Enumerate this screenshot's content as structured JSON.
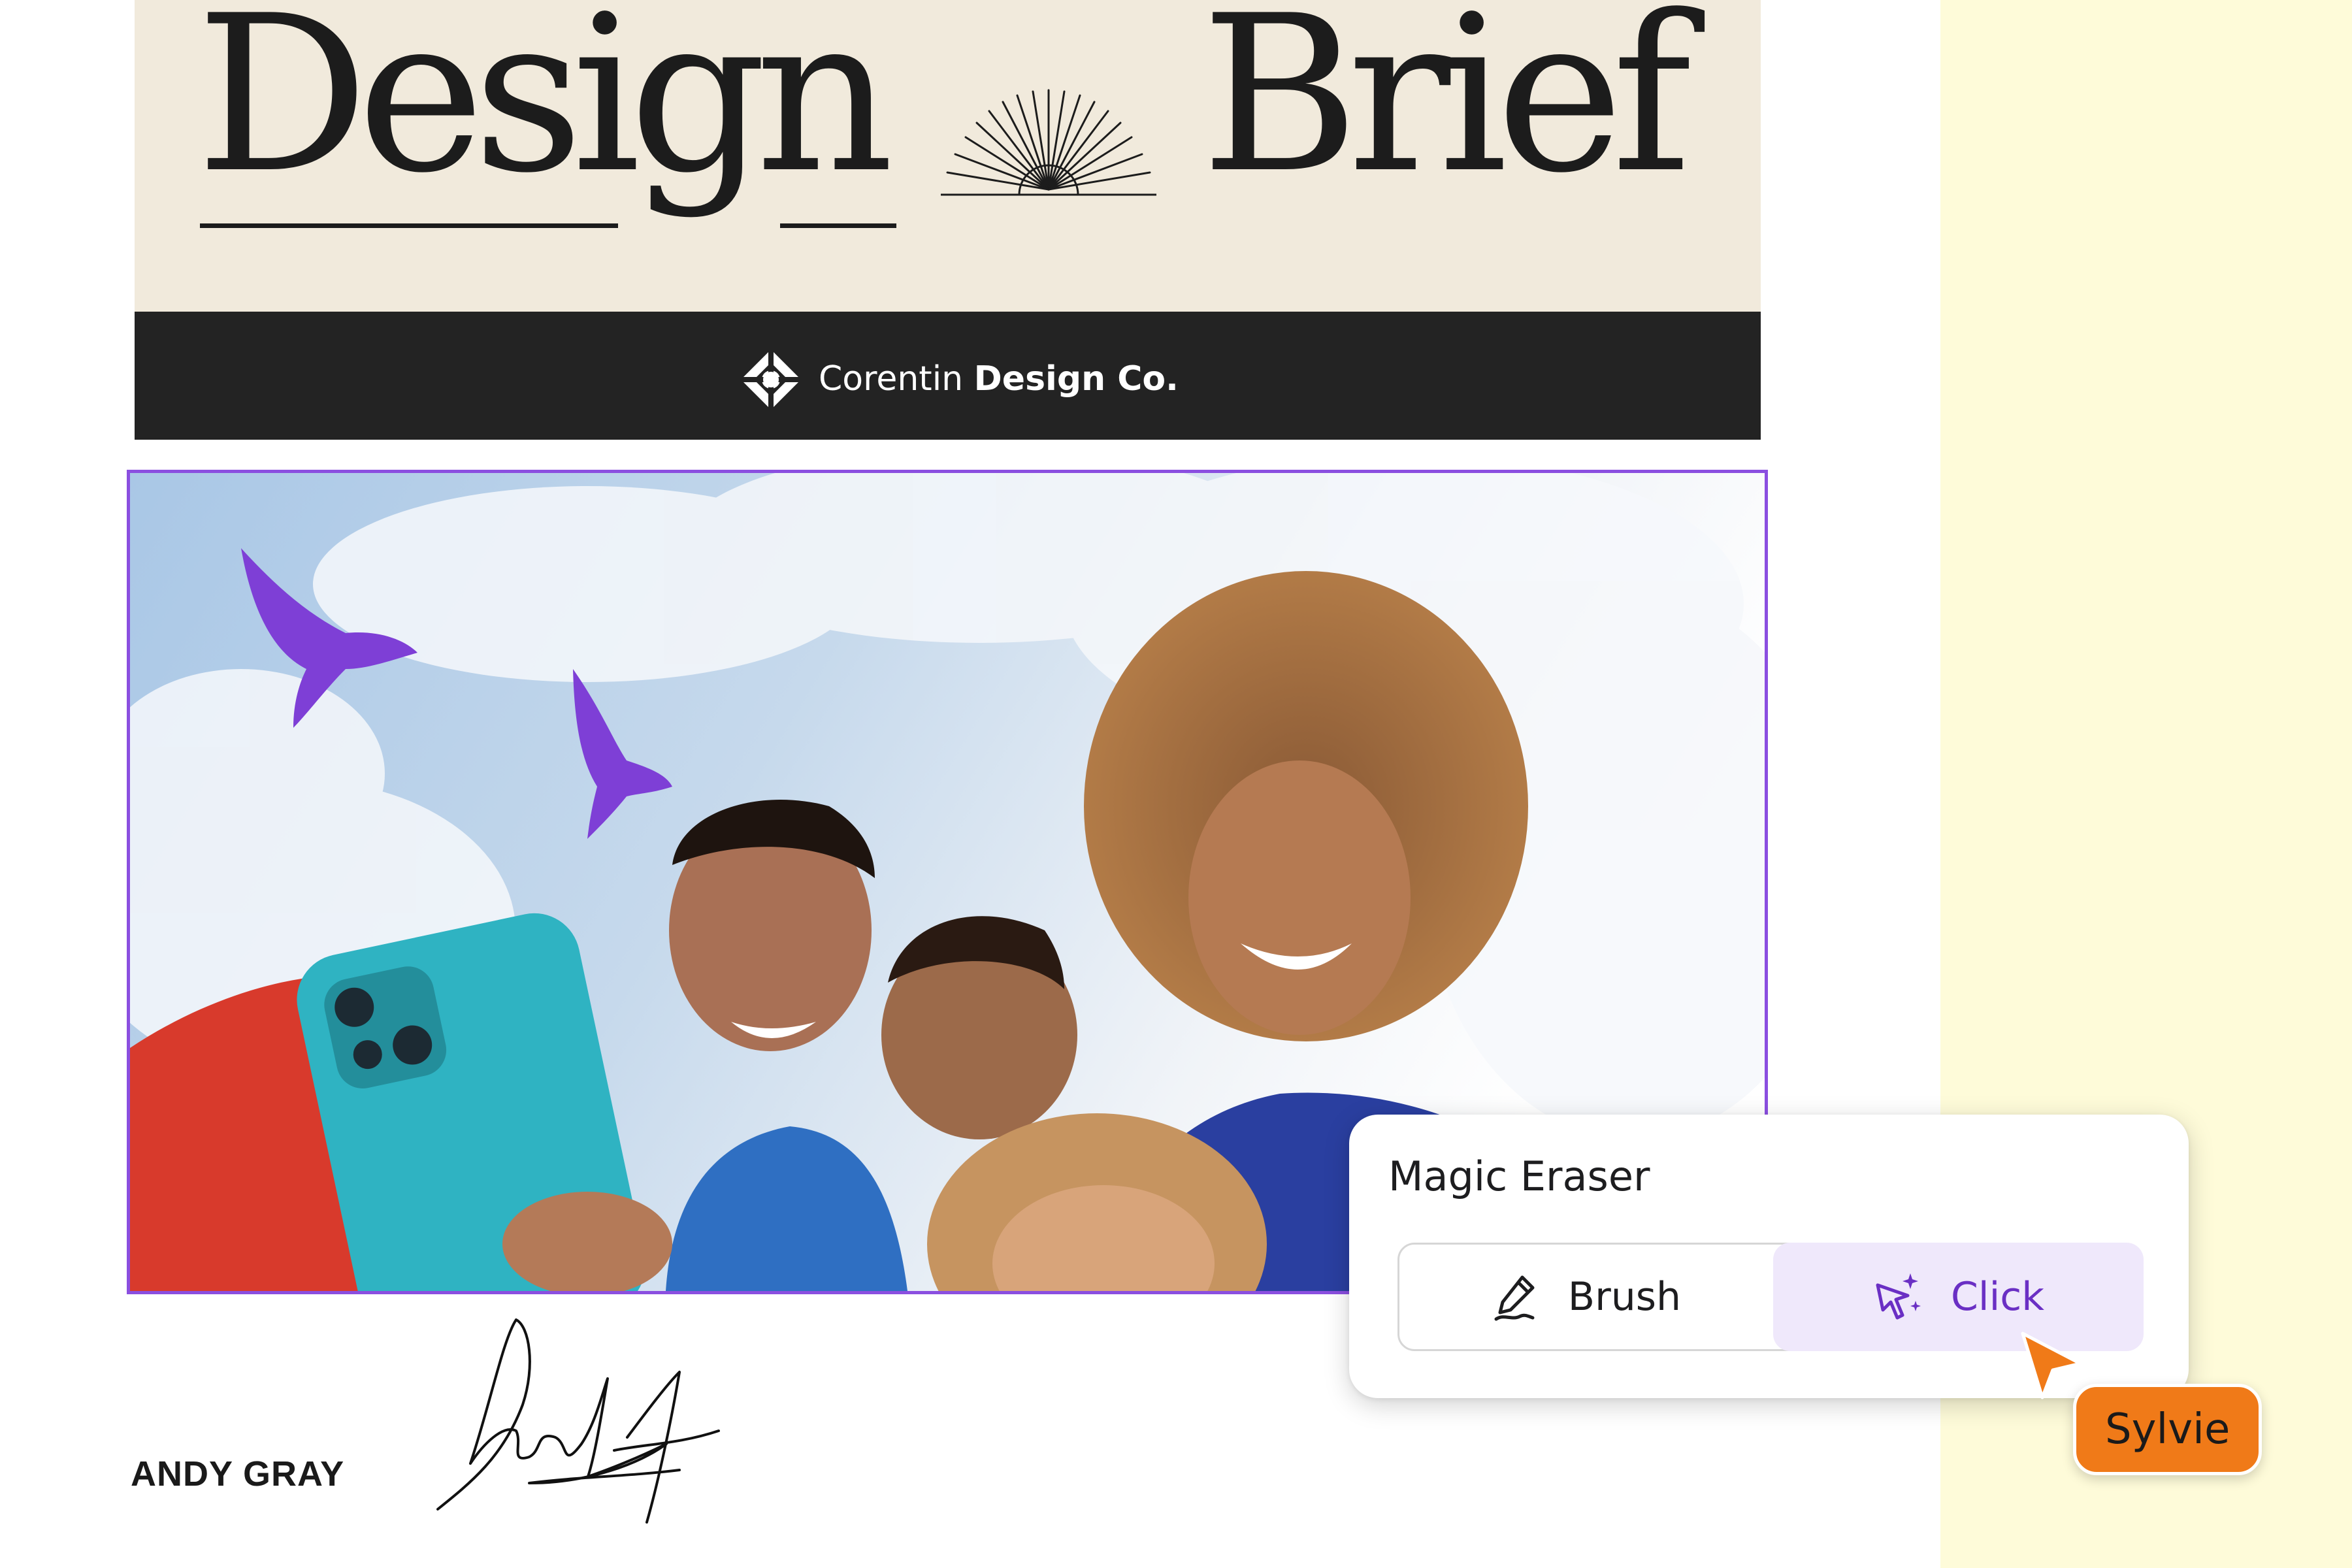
{
  "document": {
    "title_left": "Design",
    "title_right": "Brief",
    "brand": {
      "light": "Corentin",
      "bold": "Design Co."
    },
    "signature_name": "ANDY GRAY"
  },
  "magic_eraser": {
    "title": "Magic Eraser",
    "options": [
      {
        "label": "Brush",
        "icon": "brush-icon",
        "selected": false
      },
      {
        "label": "Click",
        "icon": "magic-click-icon",
        "selected": true
      }
    ]
  },
  "collaborator": {
    "name": "Sylvie",
    "color": "#f07a18"
  },
  "colors": {
    "selection": "#8b4fe0",
    "header_bg": "#f1eadc",
    "brand_bar": "#232323",
    "side_panel": "#fefbd9",
    "accent_purple": "#6a2fc4"
  }
}
